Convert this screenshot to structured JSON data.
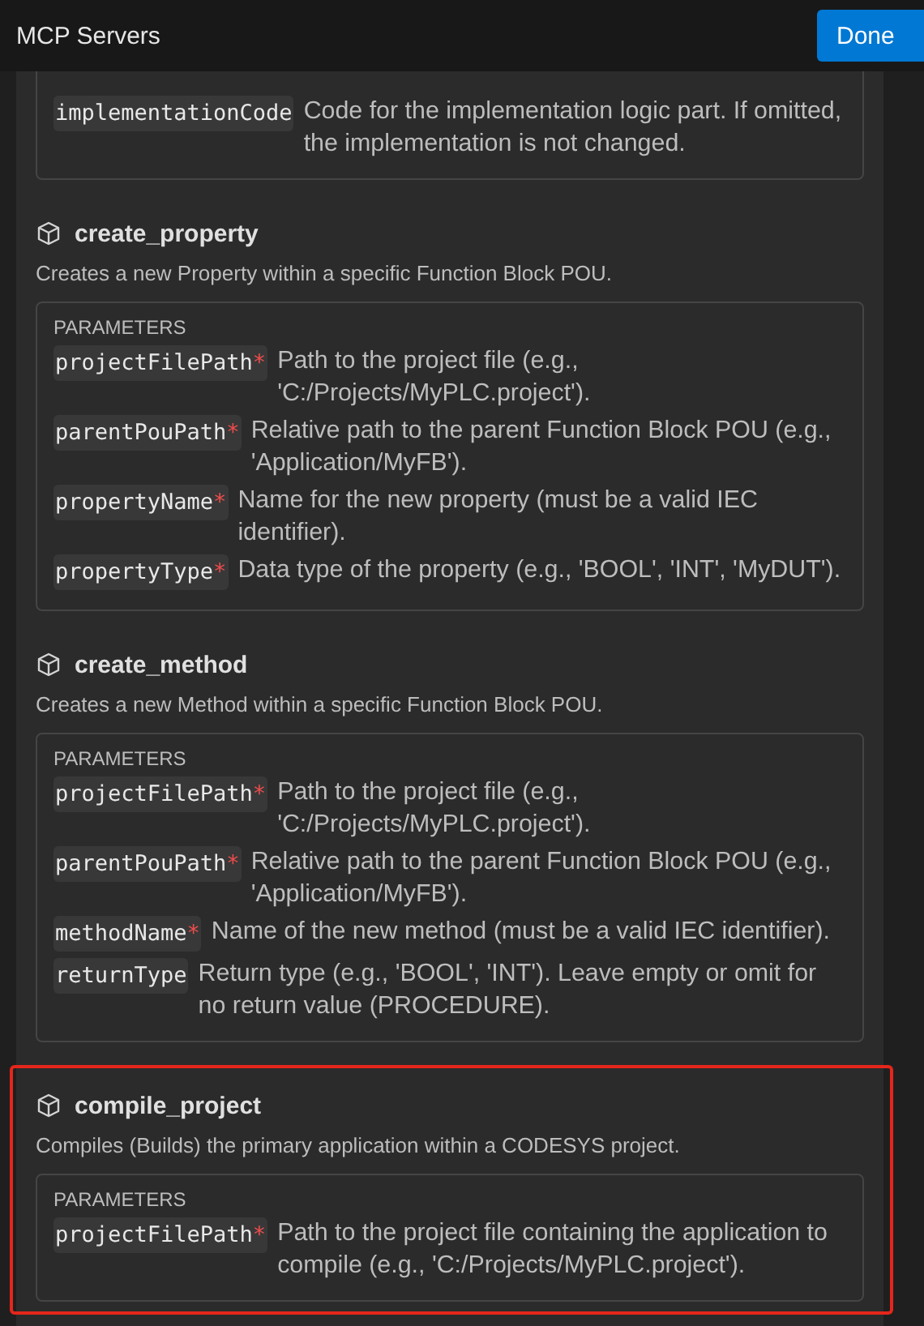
{
  "header": {
    "title": "MCP Servers",
    "done_button": "Done"
  },
  "tools": [
    {
      "highlighted": false,
      "parameters": [
        {
          "name": "implementationCode",
          "description": "Code for the implementation logic part. If omitted, the implementation is not changed."
        }
      ]
    },
    {
      "name": "create_property",
      "description": "Creates a new Property within a specific Function Block POU.",
      "highlighted": false,
      "parameters_heading": "PARAMETERS",
      "parameters": [
        {
          "name": "projectFilePath",
          "required_mark": "*",
          "description": "Path to the project file (e.g., 'C:/Projects/MyPLC.project')."
        },
        {
          "name": "parentPouPath",
          "required_mark": "*",
          "description": "Relative path to the parent Function Block POU (e.g., 'Application/MyFB')."
        },
        {
          "name": "propertyName",
          "required_mark": "*",
          "description": "Name for the new property (must be a valid IEC identifier)."
        },
        {
          "name": "propertyType",
          "required_mark": "*",
          "description": "Data type of the property (e.g., 'BOOL', 'INT', 'MyDUT')."
        }
      ]
    },
    {
      "name": "create_method",
      "description": "Creates a new Method within a specific Function Block POU.",
      "highlighted": false,
      "parameters_heading": "PARAMETERS",
      "parameters": [
        {
          "name": "projectFilePath",
          "required_mark": "*",
          "description": "Path to the project file (e.g., 'C:/Projects/MyPLC.project')."
        },
        {
          "name": "parentPouPath",
          "required_mark": "*",
          "description": "Relative path to the parent Function Block POU (e.g., 'Application/MyFB')."
        },
        {
          "name": "methodName",
          "required_mark": "*",
          "description": "Name of the new method (must be a valid IEC identifier)."
        },
        {
          "name": "returnType",
          "description": "Return type (e.g., 'BOOL', 'INT'). Leave empty or omit for no return value (PROCEDURE)."
        }
      ]
    },
    {
      "name": "compile_project",
      "description": "Compiles (Builds) the primary application within a CODESYS project.",
      "highlighted": true,
      "parameters_heading": "PARAMETERS",
      "parameters": [
        {
          "name": "projectFilePath",
          "required_mark": "*",
          "description": "Path to the project file containing the application to compile (e.g., 'C:/Projects/MyPLC.project')."
        }
      ]
    }
  ]
}
